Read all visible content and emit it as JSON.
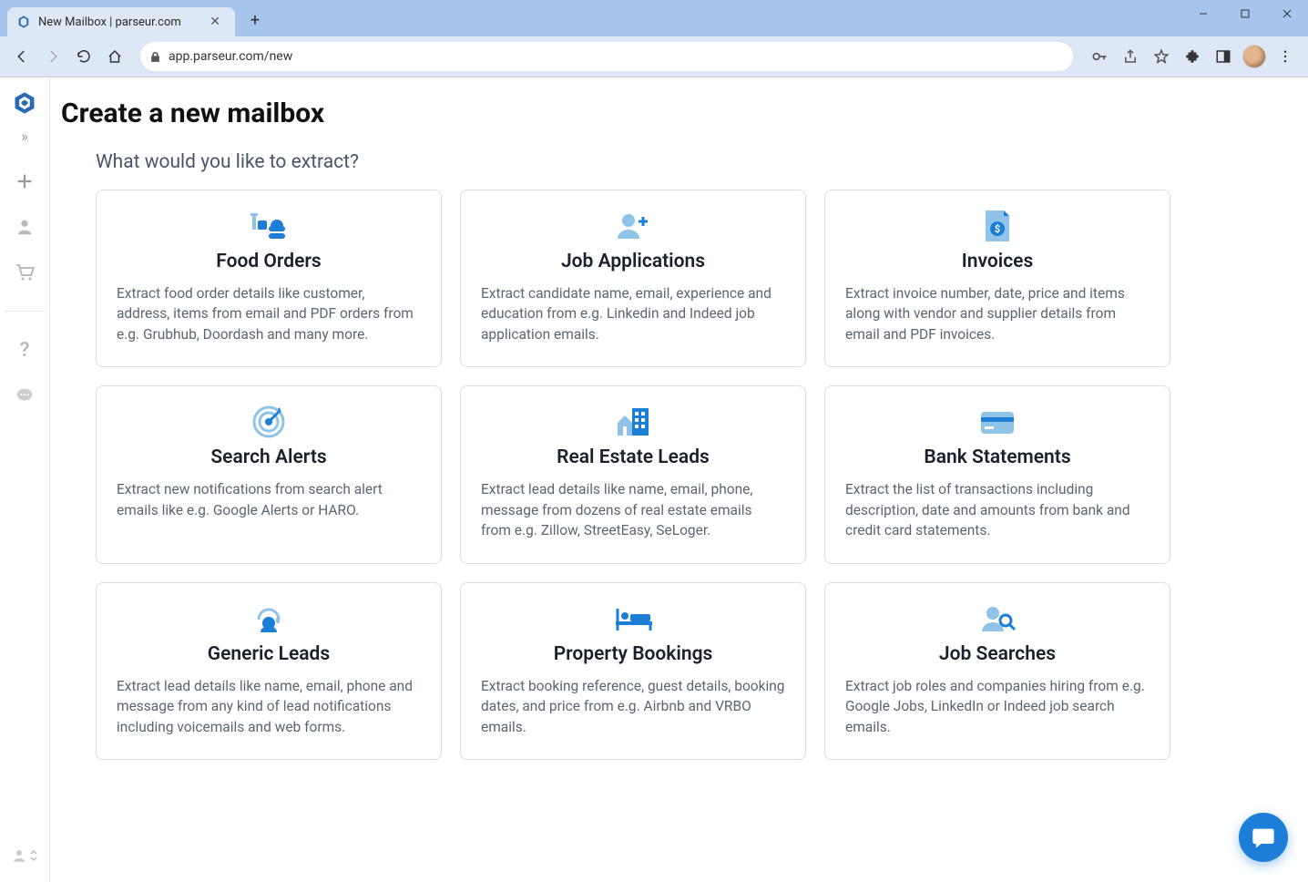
{
  "browser": {
    "tab_title": "New Mailbox | parseur.com",
    "url": "app.parseur.com/new"
  },
  "page": {
    "title": "Create a new mailbox",
    "subtitle": "What would you like to extract?"
  },
  "cards": [
    {
      "icon": "food",
      "title": "Food Orders",
      "desc": "Extract food order details like customer, address, items from email and PDF orders from e.g. Grubhub, Doordash and many more."
    },
    {
      "icon": "user-plus",
      "title": "Job Applications",
      "desc": "Extract candidate name, email, experience and education from e.g. Linkedin and Indeed job application emails."
    },
    {
      "icon": "invoice",
      "title": "Invoices",
      "desc": "Extract invoice number, date, price and items along with vendor and supplier details from email and PDF invoices."
    },
    {
      "icon": "target",
      "title": "Search Alerts",
      "desc": "Extract new notifications from search alert emails like e.g. Google Alerts or HARO."
    },
    {
      "icon": "building",
      "title": "Real Estate Leads",
      "desc": "Extract lead details like name, email, phone, message from dozens of real estate emails from e.g. Zillow, StreetEasy, SeLoger."
    },
    {
      "icon": "bank-card",
      "title": "Bank Statements",
      "desc": "Extract the list of transactions including description, date and amounts from bank and credit card statements."
    },
    {
      "icon": "headset",
      "title": "Generic Leads",
      "desc": "Extract lead details like name, email, phone and message from any kind of lead notifications including voicemails and web forms."
    },
    {
      "icon": "bed",
      "title": "Property Bookings",
      "desc": "Extract booking reference, guest details, booking dates, and price from e.g. Airbnb and VRBO emails."
    },
    {
      "icon": "user-search",
      "title": "Job Searches",
      "desc": "Extract job roles and companies hiring from e.g. Google Jobs, LinkedIn or Indeed job search emails."
    }
  ]
}
